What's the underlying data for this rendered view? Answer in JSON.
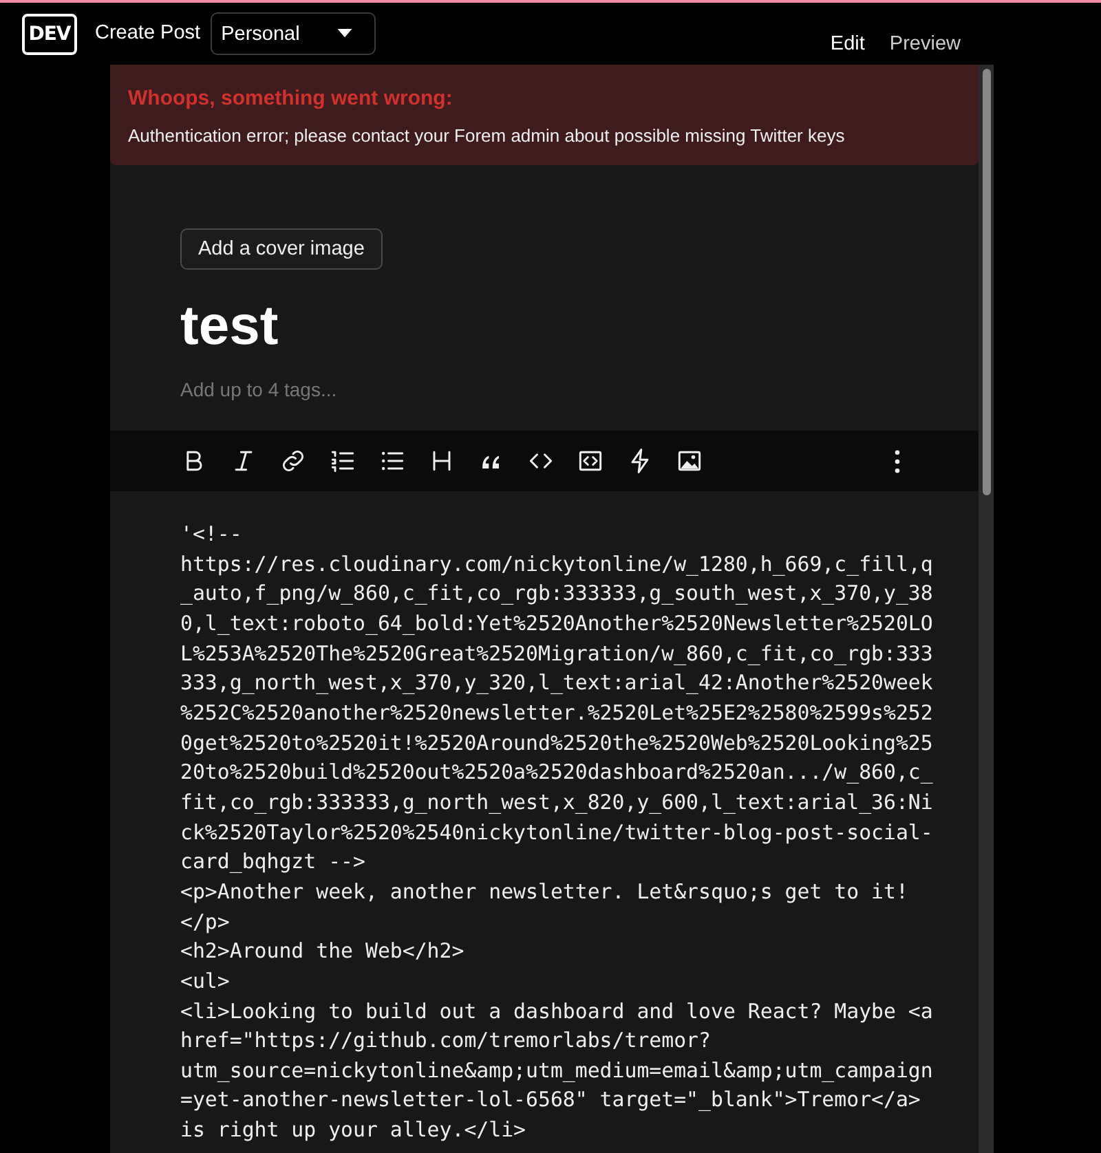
{
  "header": {
    "logo": "DEV",
    "page_title": "Create Post",
    "organization_select": {
      "value": "Personal"
    },
    "tabs": [
      {
        "label": "Edit",
        "selected": true
      },
      {
        "label": "Preview",
        "selected": false
      }
    ]
  },
  "error": {
    "title": "Whoops, something went wrong:",
    "message": "Authentication error; please contact your Forem admin about possible missing Twitter keys"
  },
  "cover_button": "Add a cover image",
  "post_title": {
    "value": "test"
  },
  "tags": {
    "placeholder": "Add up to 4 tags..."
  },
  "toolbar": [
    {
      "kind": "bold"
    },
    {
      "kind": "italic"
    },
    {
      "kind": "link"
    },
    {
      "kind": "ordered-list"
    },
    {
      "kind": "bullet-list"
    },
    {
      "kind": "heading"
    },
    {
      "kind": "quote"
    },
    {
      "kind": "code"
    },
    {
      "kind": "code-block"
    },
    {
      "kind": "embed"
    },
    {
      "kind": "image"
    },
    {
      "kind": "more"
    }
  ],
  "body": {
    "lines": [
      "'<!--",
      "https://res.cloudinary.com/nickytonline/w_1280,h_669,c_fill,q",
      "_auto,f_png/w_860,c_fit,co_rgb:333333,g_south_west,x_370,y_38",
      "0,l_text:roboto_64_bold:Yet%2520Another%2520Newsletter%2520LO",
      "L%253A%2520The%2520Great%2520Migration/w_860,c_fit,co_rgb:333",
      "333,g_north_west,x_370,y_320,l_text:arial_42:Another%2520week",
      "%252C%2520another%2520newsletter.%2520Let%25E2%2580%2599s%252",
      "0get%2520to%2520it!%2520Around%2520the%2520Web%2520Looking%25",
      "20to%2520build%2520out%2520a%2520dashboard%2520an.../w_860,c_",
      "fit,co_rgb:333333,g_north_west,x_820,y_600,l_text:arial_36:Ni",
      "ck%2520Taylor%2520%2540nickytonline/twitter-blog-post-social-",
      "card_bqhgzt -->",
      "<p>Another week, another newsletter. Let&rsquo;s get to it!",
      "</p>",
      "<h2>Around the Web</h2>",
      "<ul>",
      "<li>Looking to build out a dashboard and love React? Maybe <a",
      "href=\"https://github.com/tremorlabs/tremor?",
      "utm_source=nickytonline&amp;utm_medium=email&amp;utm_campaign",
      "=yet-another-newsletter-lol-6568\" target=\"_blank\">Tremor</a>",
      "is right up your alley.</li>"
    ]
  }
}
